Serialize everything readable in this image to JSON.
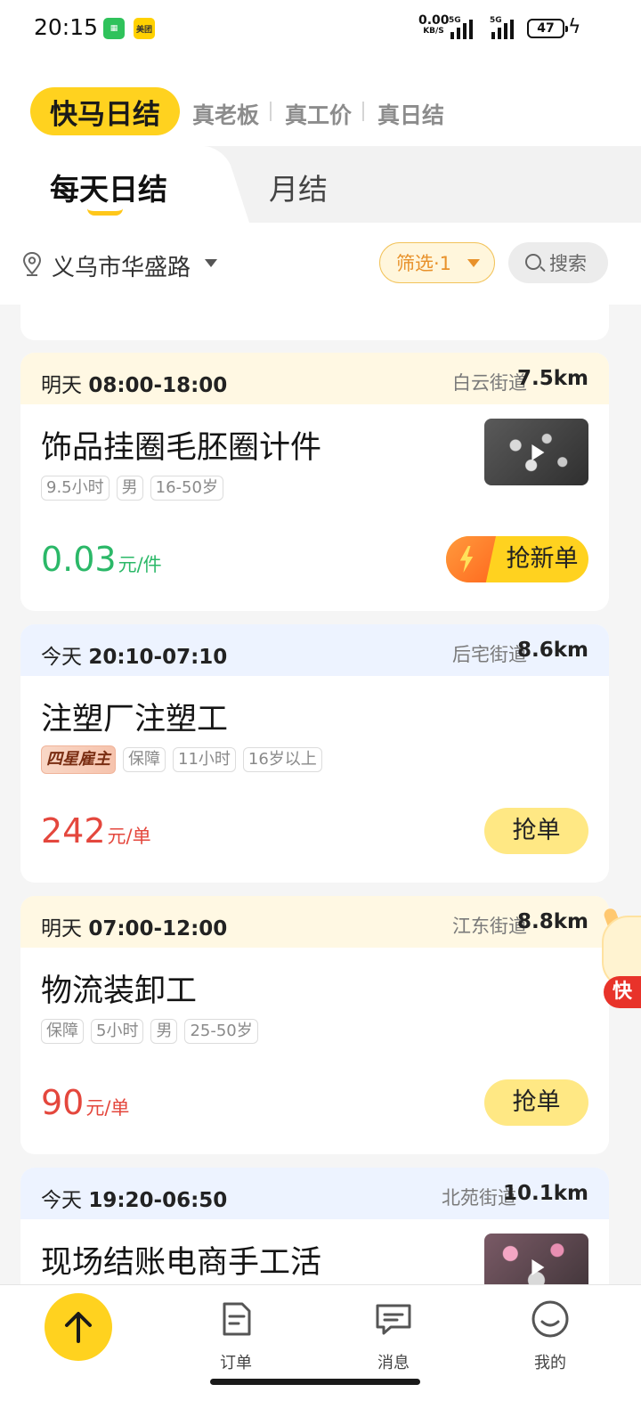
{
  "status_bar": {
    "time": "20:15",
    "app_icons": [
      "green-app",
      "美团"
    ],
    "net_speed_value": "0.00",
    "net_speed_unit": "KB/S",
    "signal_label_1": "5G",
    "signal_label_2": "5G",
    "battery": "47"
  },
  "header": {
    "brand": "快马日结",
    "slogans": [
      "真老板",
      "真工价",
      "真日结"
    ]
  },
  "tabs": [
    {
      "label": "每天日结",
      "active": true
    },
    {
      "label": "月结",
      "active": false
    }
  ],
  "filter": {
    "location": "义乌市华盛路",
    "filter_label": "筛选·1",
    "search_placeholder": "搜索"
  },
  "jobs": [
    {
      "day": "明天",
      "time": "08:00-18:00",
      "street": "白云街道",
      "distance": "7.5km",
      "title": "饰品挂圈毛胚圈计件",
      "tags": [
        "9.5小时",
        "男",
        "16-50岁"
      ],
      "price": "0.03",
      "unit": "元/件",
      "button": "抢新单",
      "has_video": true
    },
    {
      "day": "今天",
      "time": "20:10-07:10",
      "street": "后宅街道",
      "distance": "8.6km",
      "title": "注塑厂注塑工",
      "star_tag": "四星雇主",
      "tags": [
        "保障",
        "11小时",
        "16岁以上"
      ],
      "price": "242",
      "unit": "元/单",
      "button": "抢单",
      "has_video": false
    },
    {
      "day": "明天",
      "time": "07:00-12:00",
      "street": "江东街道",
      "distance": "8.8km",
      "title": "物流装卸工",
      "tags": [
        "保障",
        "5小时",
        "男",
        "25-50岁"
      ],
      "price": "90",
      "unit": "元/单",
      "button": "抢单",
      "has_video": false
    },
    {
      "day": "今天",
      "time": "19:20-06:50",
      "street": "北苑街道",
      "distance": "10.1km",
      "title": "现场结账电商手工活",
      "has_video": true
    }
  ],
  "mascot_label": "快",
  "bottom_nav": [
    {
      "label": "订单",
      "icon": "order-icon"
    },
    {
      "label": "消息",
      "icon": "message-icon"
    },
    {
      "label": "我的",
      "icon": "profile-icon"
    }
  ],
  "colors": {
    "brand_yellow": "#ffd21f",
    "price_green": "#2bb868",
    "price_red": "#e4473d"
  }
}
